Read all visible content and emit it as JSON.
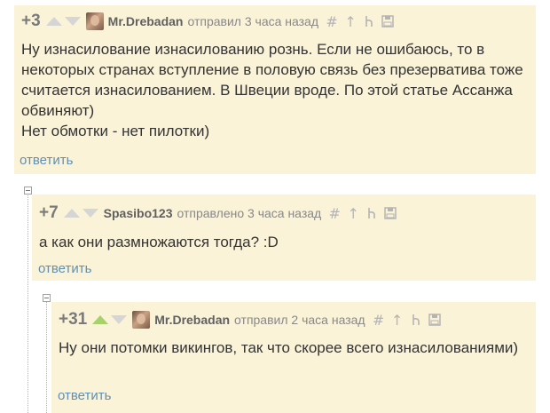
{
  "comments": [
    {
      "rating": "+3",
      "author": "Mr.Drebadan",
      "meta": "отправил 3 часа назад",
      "text": "Ну изнасилование изнасилованию рознь. Если не ошибаюсь, то в некоторых странах вступление в половую связь без презерватива тоже считается изнасилованием. В Швеции вроде. По этой статье Ассанжа обвиняют)\nНет обмотки - нет пилотки)",
      "reply": "ответить",
      "upvoted": false
    },
    {
      "rating": "+7",
      "author": "Spasibo123",
      "meta": "отправлено 3 часа назад",
      "text": "а как они размножаются тогда? :D",
      "reply": "ответить",
      "upvoted": false
    },
    {
      "rating": "+31",
      "author": "Mr.Drebadan",
      "meta": "отправил 2 часа назад",
      "text": "Ну они потомки викингов, так что скорее всего изнасилованиями)",
      "reply": "ответить",
      "upvoted": true
    }
  ],
  "tools": {
    "hash": "#",
    "parent": "↑"
  },
  "colors": {
    "background": "#faf3d8",
    "link": "#5f8fb4",
    "upvote_active": "#a7d16a",
    "arrow_inactive": "#d5d5d5"
  },
  "icons": [
    "avatar",
    "upvote-arrow-icon",
    "downvote-arrow-icon",
    "hash-link-icon",
    "parent-arrow-icon",
    "branch-icon",
    "save-icon",
    "collapse-icon"
  ]
}
